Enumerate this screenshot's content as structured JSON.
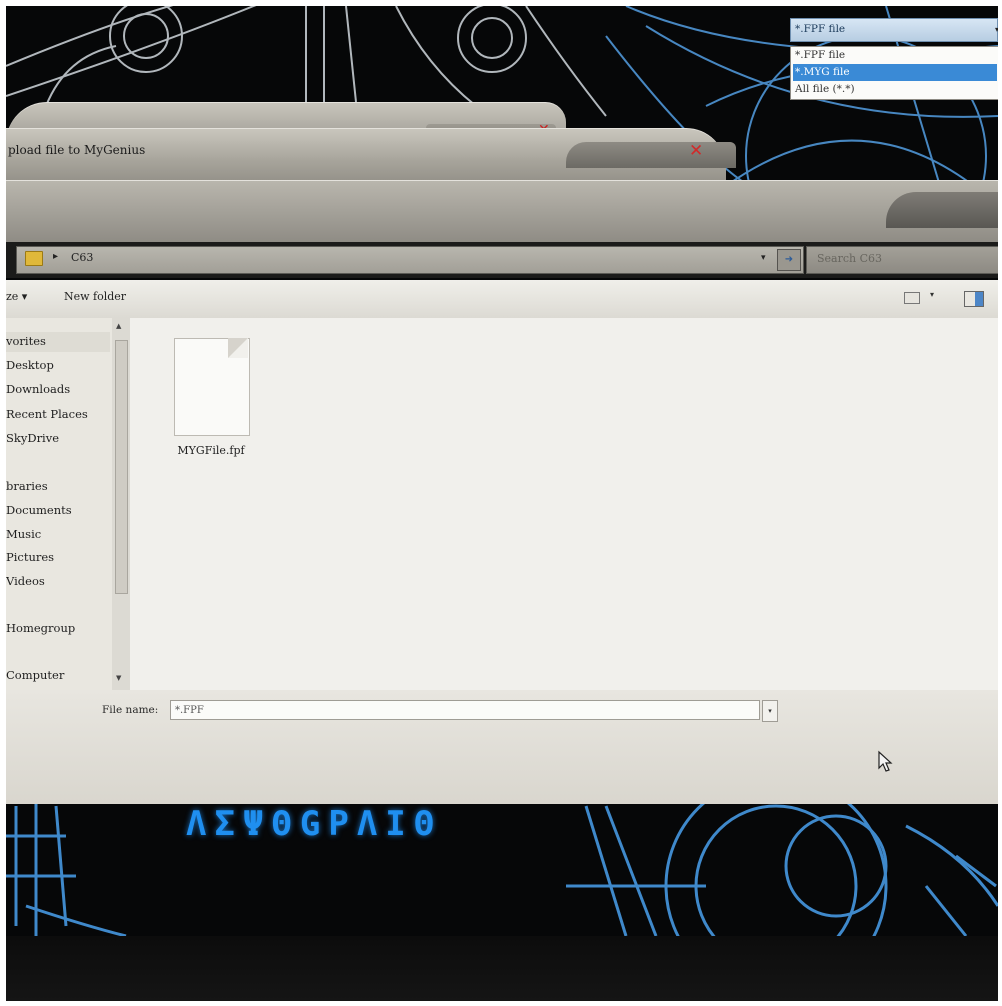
{
  "dialog": {
    "title": "pload file to MyGenius",
    "close_glyph": "✕"
  },
  "address": {
    "crumb_arrow": "▸",
    "path": "C63",
    "dropdown_glyph": "▾",
    "refresh_glyph": "➜",
    "search_placeholder": "Search C63"
  },
  "toolbar": {
    "organize": "ze ▾",
    "new_folder": "New folder",
    "views_dropdown": "▾"
  },
  "nav": {
    "scroll_up": "▲",
    "scroll_down": "▼",
    "items": [
      "vorites",
      "Desktop",
      "Downloads",
      "Recent Places",
      "SkyDrive",
      "braries",
      "Documents",
      "Music",
      "Pictures",
      "Videos",
      "Homegroup",
      "Computer"
    ]
  },
  "files": [
    {
      "name": "MYGFile.fpf",
      "icon": "document-icon"
    }
  ],
  "footer": {
    "file_name_label": "File name:",
    "file_name_value": "*.FPF",
    "file_name_dropdown": "▾",
    "file_type_selected": "*.FPF file",
    "file_type_arrow": "▾",
    "file_type_options": [
      "*.FPF file",
      "*.MYG file",
      "All file (*.*)"
    ],
    "highlighted_option_index": 1
  },
  "logo_text": "ΛΣΨΘGΡΛIΘ",
  "colors": {
    "accent_blue": "#3a8ad6",
    "close_red": "#d12a2a",
    "neon_blue": "#1f8ff0"
  }
}
